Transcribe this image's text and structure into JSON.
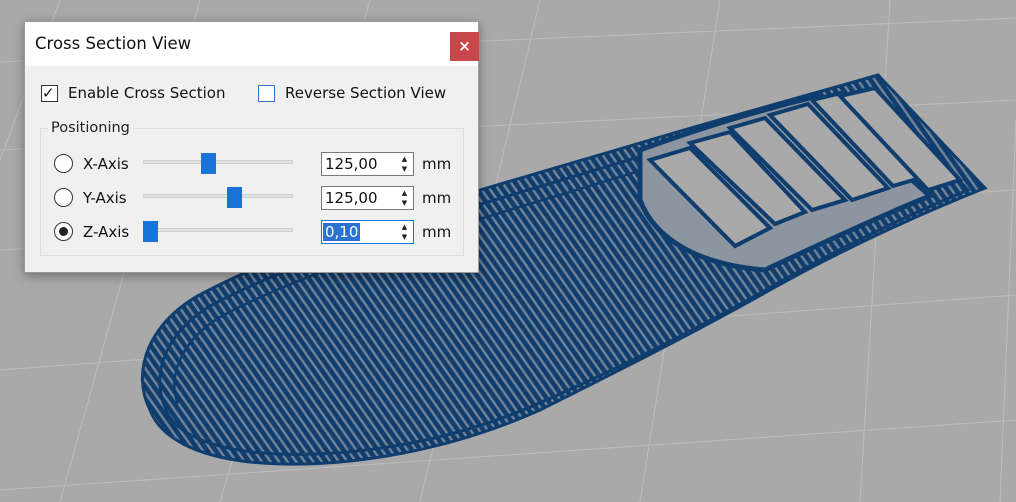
{
  "dialog": {
    "title": "Cross Section View",
    "close_icon": "×",
    "enable_cross_section": {
      "label": "Enable Cross Section",
      "checked": true
    },
    "reverse_section_view": {
      "label": "Reverse Section View",
      "checked": false
    },
    "positioning": {
      "legend": "Positioning",
      "axes": [
        {
          "label": "X-Axis",
          "selected": false,
          "value": "125,00",
          "unit": "mm",
          "slider_fraction": 0.45
        },
        {
          "label": "Y-Axis",
          "selected": false,
          "value": "125,00",
          "unit": "mm",
          "slider_fraction": 0.6
        },
        {
          "label": "Z-Axis",
          "selected": true,
          "value": "0,10",
          "unit": "mm",
          "slider_fraction": 0.0
        }
      ]
    },
    "spin_up_icon": "▲",
    "spin_down_icon": "▼",
    "check_icon": "✓"
  },
  "colors": {
    "background": "#a9a9a9",
    "grid_line": "#bdbdbd",
    "part_fill": "#0f3d6e",
    "close_button": "#c8474a",
    "accent": "#1a73d8"
  }
}
